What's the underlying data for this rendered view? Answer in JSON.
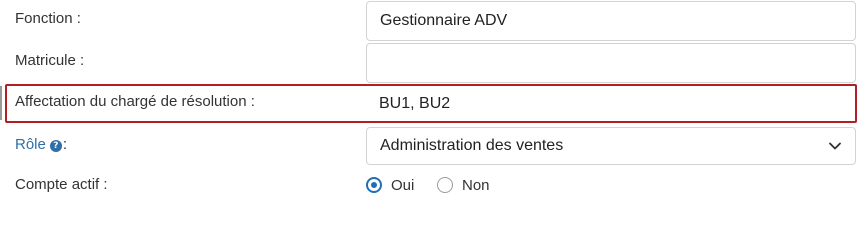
{
  "form": {
    "fonction": {
      "label": "Fonction :",
      "value": "Gestionnaire ADV"
    },
    "matricule": {
      "label": "Matricule :",
      "value": ""
    },
    "affectation": {
      "label": "Affectation du chargé de résolution :",
      "value": "BU1, BU2"
    },
    "role": {
      "label": "Rôle",
      "help_icon": "?",
      "suffix": ":",
      "selected": "Administration des ventes"
    },
    "compte_actif": {
      "label": "Compte actif :",
      "options": [
        {
          "label": "Oui",
          "checked": true
        },
        {
          "label": "Non",
          "checked": false
        }
      ]
    }
  },
  "icons": {
    "help": "question-circle-icon",
    "dropdown": "chevron-down-icon"
  },
  "colors": {
    "highlight_border": "#b11f24",
    "link_label": "#2f6fa8",
    "radio_checked": "#1f6fb6",
    "input_border": "#d3d3d3"
  }
}
